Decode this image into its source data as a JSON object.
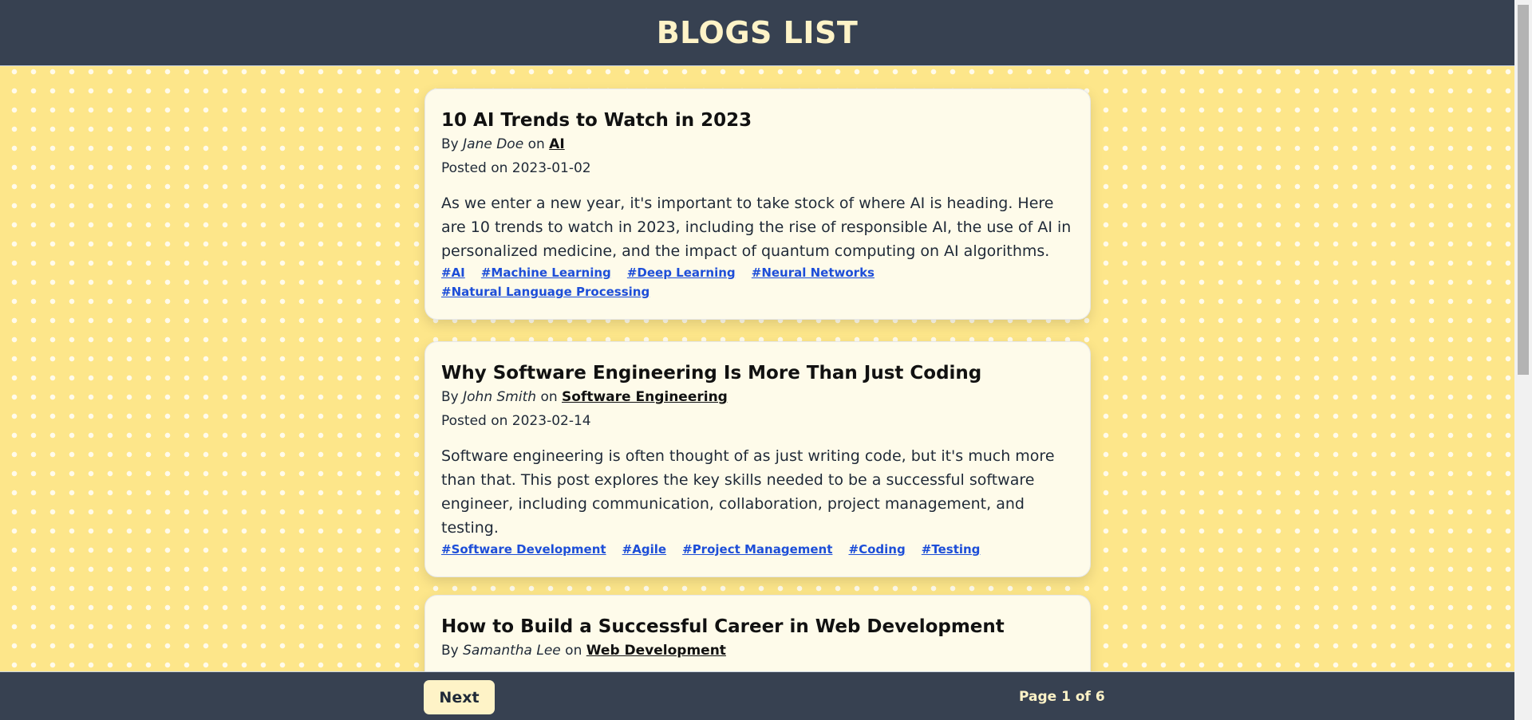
{
  "header": {
    "title": "BLOGS LIST"
  },
  "posts": [
    {
      "title": "10 AI Trends to Watch in 2023",
      "by_label": "By",
      "author": "Jane Doe",
      "on_label": "on",
      "category": "AI",
      "posted": "Posted on 2023-01-02",
      "body": "As we enter a new year, it's important to take stock of where AI is heading. Here are 10 trends to watch in 2023, including the rise of responsible AI, the use of AI in personalized medicine, and the impact of quantum computing on AI algorithms.",
      "tags": [
        "#AI",
        "#Machine Learning",
        "#Deep Learning",
        "#Neural Networks",
        "#Natural Language Processing"
      ]
    },
    {
      "title": "Why Software Engineering Is More Than Just Coding",
      "by_label": "By",
      "author": "John Smith",
      "on_label": "on",
      "category": "Software Engineering",
      "posted": "Posted on 2023-02-14",
      "body": "Software engineering is often thought of as just writing code, but it's much more than that. This post explores the key skills needed to be a successful software engineer, including communication, collaboration, project management, and testing.",
      "tags": [
        "#Software Development",
        "#Agile",
        "#Project Management",
        "#Coding",
        "#Testing"
      ]
    },
    {
      "title": "How to Build a Successful Career in Web Development",
      "by_label": "By",
      "author": "Samantha Lee",
      "on_label": "on",
      "category": "Web Development"
    }
  ],
  "footer": {
    "next_label": "Next",
    "page_info": "Page 1 of 6"
  }
}
